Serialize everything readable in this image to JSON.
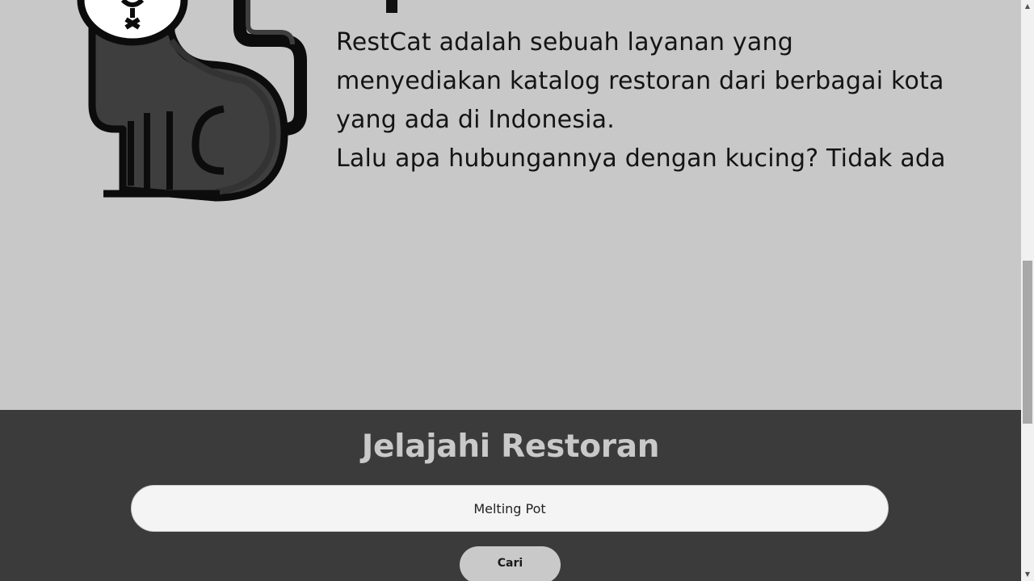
{
  "about": {
    "paragraph_1": "RestCat adalah sebuah layanan yang menyediakan katalog restoran dari berbagai kota yang ada di Indonesia.",
    "paragraph_2": "Lalu apa hubungannya dengan kucing? Tidak ada",
    "illustration_icon": "cat-icon"
  },
  "explore": {
    "title": "Jelajahi Restoran",
    "search_value": "Melting Pot",
    "search_button_label": "Cari"
  },
  "scrollbar": {
    "up_arrow": "▲",
    "down_arrow": "▼"
  },
  "colors": {
    "page_background": "#c8c8c8",
    "explore_background": "#3b3b3b",
    "title_color": "#c9c9c9",
    "input_background": "#f4f4f4",
    "button_background": "#c9c9c9"
  }
}
